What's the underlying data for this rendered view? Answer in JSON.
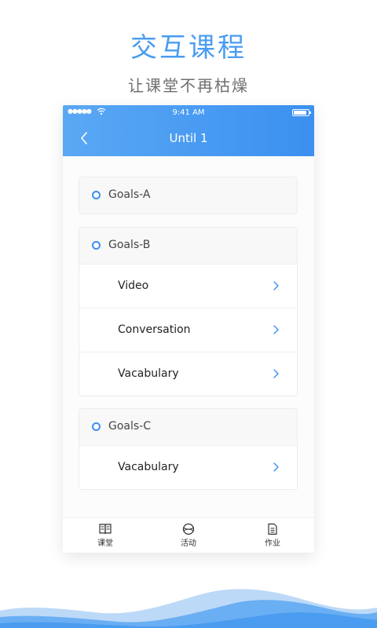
{
  "promo": {
    "title": "交互课程",
    "subtitle": "让课堂不再枯燥"
  },
  "status_bar": {
    "signal": "●●●●●",
    "time": "9:41 AM"
  },
  "nav": {
    "title": "Until 1",
    "back_icon": "chevron-left-icon"
  },
  "goals": [
    {
      "label": "Goals-A",
      "items": []
    },
    {
      "label": "Goals-B",
      "items": [
        {
          "label": "Video"
        },
        {
          "label": "Conversation"
        },
        {
          "label": "Vacabulary"
        }
      ]
    },
    {
      "label": "Goals-C",
      "items": [
        {
          "label": "Vacabulary"
        }
      ]
    }
  ],
  "tabs": [
    {
      "label": "课堂",
      "icon": "book-icon"
    },
    {
      "label": "活动",
      "icon": "ball-icon"
    },
    {
      "label": "作业",
      "icon": "document-icon"
    }
  ],
  "colors": {
    "accent": "#3b90f0",
    "header_start": "#5aa8f4",
    "header_end": "#3b90f0",
    "wave": "#4a9cf0"
  }
}
